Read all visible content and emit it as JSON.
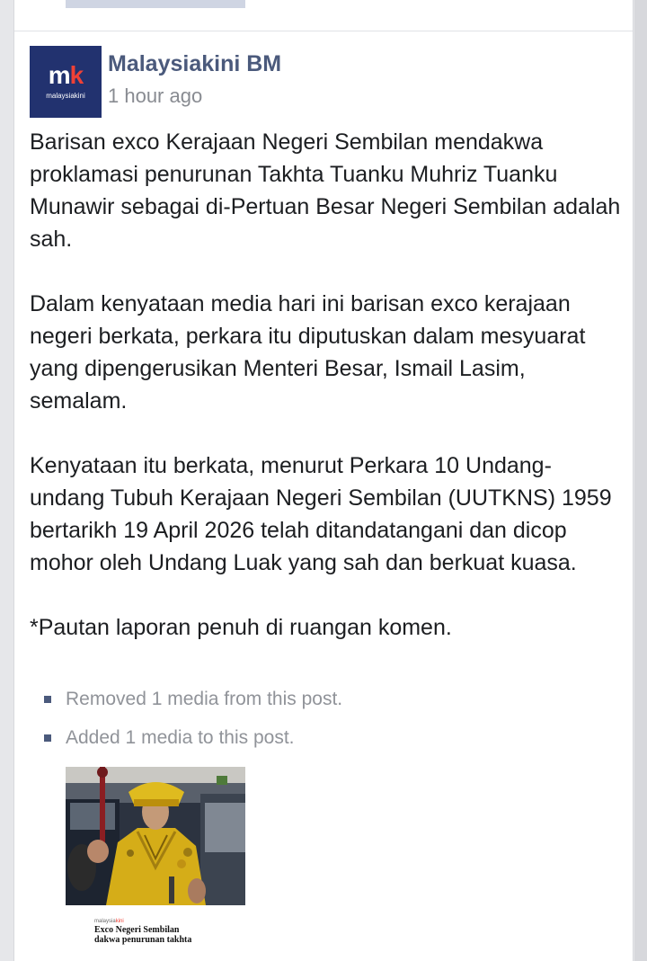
{
  "post": {
    "page_name": "Malaysiakini BM",
    "time": "1 hour ago",
    "avatar": {
      "logo_text_main": "m",
      "logo_text_accent": "k",
      "logo_subtext": "malaysiakini"
    },
    "paragraphs": [
      "Barisan exco Kerajaan Negeri Sembilan mendakwa proklamasi penurunan Takhta Tuanku Muhriz Tuanku Munawir sebagai di-Pertuan Besar Negeri Sembilan adalah sah.",
      "Dalam kenyataan media hari ini barisan exco kerajaan negeri berkata, perkara itu diputuskan dalam mesyuarat yang dipengerusikan Menteri Besar, Ismail Lasim, semalam.",
      "Kenyataan itu berkata, menurut Perkara 10 Undang-undang Tubuh Kerajaan Negeri Sembilan (UUTKNS) 1959 bertarikh 19 April 2026 telah ditandatangani dan dicop mohor oleh Undang Luak yang sah dan berkuat kuasa.",
      "*Pautan laporan penuh di ruangan komen."
    ],
    "edit_history": [
      "Removed 1 media from this post.",
      "Added 1 media to this post."
    ],
    "media_preview": {
      "brand_main": "malaysia",
      "brand_accent": "kini",
      "title_line_1": "Exco Negeri Sembilan",
      "title_line_2": "dakwa penurunan takhta"
    }
  },
  "colors": {
    "brand_navy": "#22326f",
    "brand_red": "#ef4136",
    "page_name": "#4b5a7c",
    "muted_text": "#888b91",
    "body_text": "#1c1e21"
  }
}
